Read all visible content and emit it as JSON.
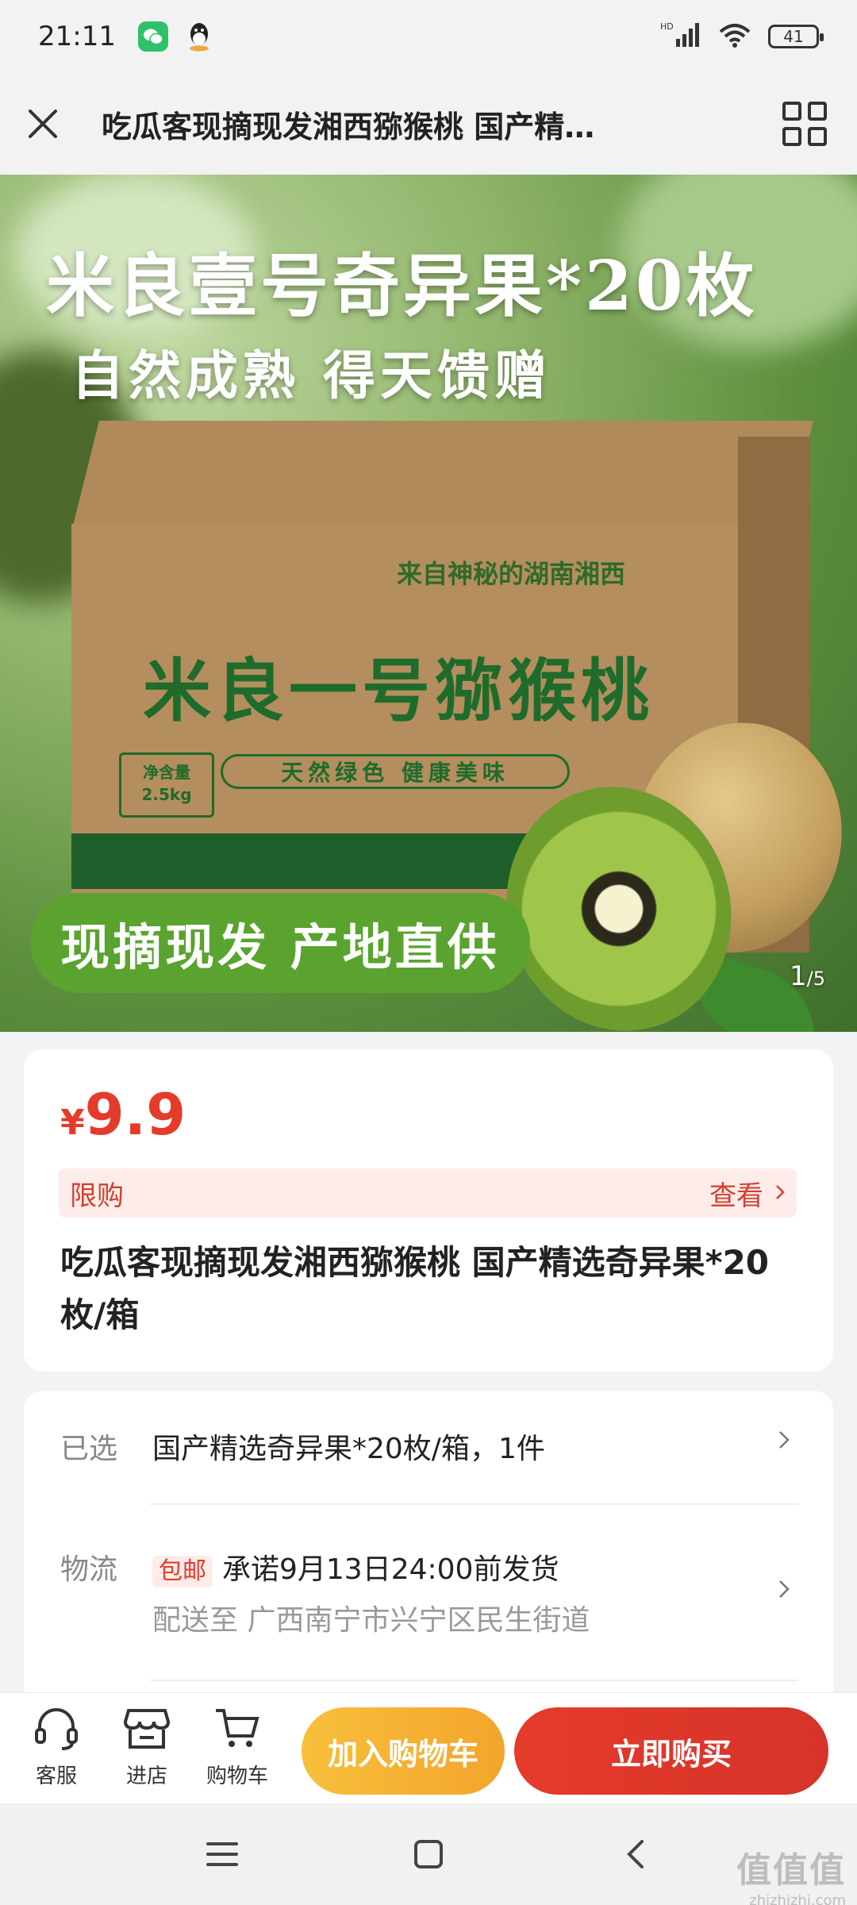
{
  "status_bar": {
    "time": "21:11",
    "battery": "41",
    "network_label": "HD",
    "icons": [
      "wechat-icon",
      "qq-icon",
      "signal-icon",
      "wifi-icon",
      "battery-icon"
    ]
  },
  "header": {
    "title": "吃瓜客现摘现发湘西猕猴桃 国产精…"
  },
  "hero": {
    "headline": "米良壹号奇异果*20枚",
    "subline": "自然成熟 得天馈赠",
    "box_origin": "来自神秘的湖南湘西",
    "box_brand": "米良一号猕猴桃",
    "box_weight_label": "净含量",
    "box_weight_value": "2.5kg",
    "box_slogan": "天然绿色 健康美味",
    "tag": "现摘现发 产地直供",
    "counter_current": "1",
    "counter_total": "/5"
  },
  "price": {
    "currency": "¥",
    "value": "9.9",
    "limit_label": "限购",
    "limit_link": "查看"
  },
  "product": {
    "title": "吃瓜客现摘现发湘西猕猴桃 国产精选奇异果*20枚/箱"
  },
  "options": {
    "selected_label": "已选",
    "selected_value": "国产精选奇异果*20枚/箱，1件",
    "shipping_label": "物流",
    "free_shipping_tag": "包邮",
    "shipping_promise": "承诺9月13日24:00前发货",
    "delivery_address": "配送至 广西南宁市兴宁区民生街道"
  },
  "actions": {
    "service_label": "客服",
    "store_label": "进店",
    "cart_label": "购物车",
    "add_to_cart": "加入购物车",
    "buy_now": "立即购买"
  },
  "watermark": {
    "logo": "值值值",
    "url": "zhizhizhi.com"
  },
  "colors": {
    "accent_red": "#e43b2b",
    "cart_yellow": "#f3a52b",
    "hero_tag_green": "#5aa32f"
  }
}
